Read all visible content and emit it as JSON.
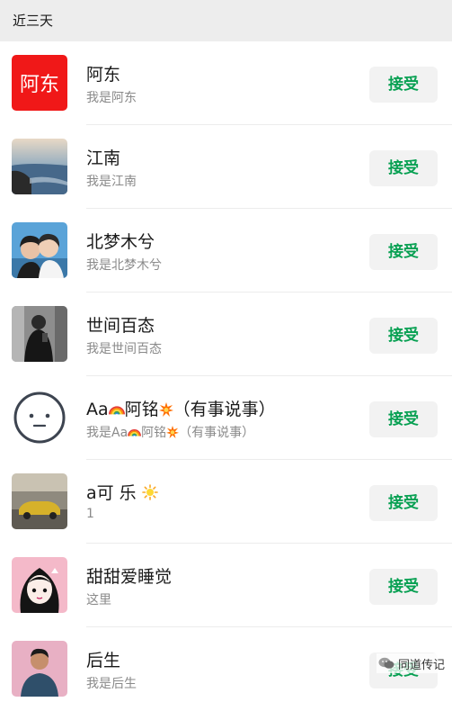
{
  "section": {
    "title": "近三天"
  },
  "requests": [
    {
      "name": "阿东",
      "message": "我是阿东",
      "action": "接受",
      "avatar_text": "阿东",
      "avatar_color": "#f01818"
    },
    {
      "name": "江南",
      "message": "我是江南",
      "action": "接受"
    },
    {
      "name": "北梦木兮",
      "message": "我是北梦木兮",
      "action": "接受"
    },
    {
      "name": "世间百态",
      "message": "我是世间百态",
      "action": "接受"
    },
    {
      "name_prefix": "Aa",
      "name_mid": "阿铭",
      "name_suffix": "（有事说事）",
      "message_prefix": "我是Aa",
      "message_mid": "阿铭",
      "message_suffix": "（有事说事）",
      "action": "接受"
    },
    {
      "name": "a可 乐",
      "message": "1",
      "action": "接受"
    },
    {
      "name": "甜甜爱睡觉",
      "message": "这里",
      "action": "接受"
    },
    {
      "name": "后生",
      "message": "我是后生",
      "action": "接受"
    }
  ],
  "watermark": {
    "text": "同道传记",
    "icon": "wechat-icon"
  },
  "colors": {
    "accent": "#07a052",
    "button_bg": "#f2f2f2",
    "header_bg": "#ededed"
  }
}
